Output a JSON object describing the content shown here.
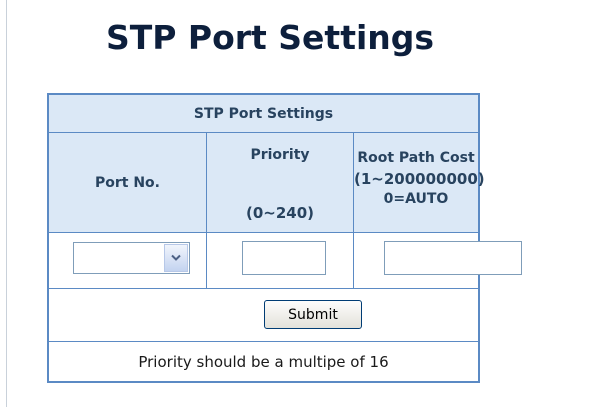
{
  "page": {
    "title": "STP Port Settings"
  },
  "table": {
    "caption": "STP Port Settings",
    "headers": {
      "port": "Port No.",
      "priority_label": "Priority",
      "priority_range": "(0~240)",
      "cost_label": "Root Path Cost",
      "cost_range": "(1~200000000)",
      "cost_auto": "0=AUTO"
    },
    "inputs": {
      "port_selected": "",
      "priority_value": "",
      "cost_value": ""
    },
    "submit_label": "Submit",
    "note": "Priority should be a multipe of 16"
  },
  "icons": {
    "dropdown": "chevron-down-icon"
  },
  "colors": {
    "header_bg": "#dbe8f6",
    "border": "#5b8ac4",
    "header_text": "#28435f",
    "title_text": "#0d1f3c"
  }
}
